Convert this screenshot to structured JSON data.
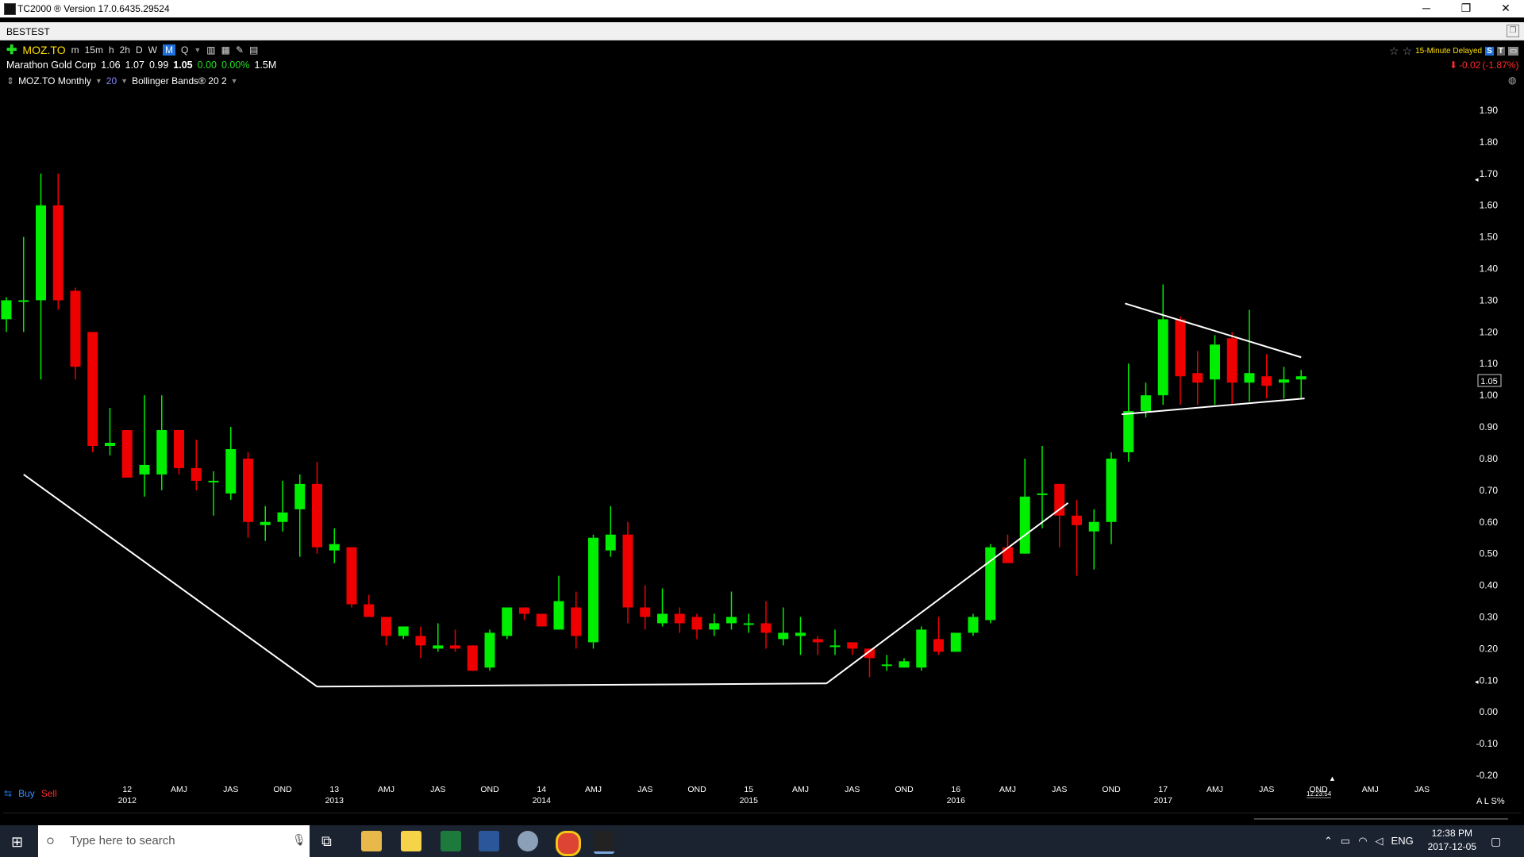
{
  "window": {
    "title": "TC2000 ® Version 17.0.6435.29524",
    "layout_name": "BESTEST",
    "controls": [
      "─",
      "❐",
      "✕"
    ]
  },
  "chart_header": {
    "symbol": "MOZ.TO",
    "timeframes": [
      "m",
      "15m",
      "h",
      "2h",
      "D",
      "W",
      "M",
      "Q"
    ],
    "active_timeframe": "M",
    "delayed_label": "15-Minute Delayed",
    "company": "Marathon Gold Corp",
    "open": "1.06",
    "high": "1.07",
    "low": "0.99",
    "close": "1.05",
    "change": "0.00",
    "change_pct": "0.00%",
    "volume": "1.5M",
    "day_change": "-0.02",
    "day_change_pct": "(-1.87%)",
    "plot_label": "MOZ.TO Monthly",
    "plot_period": "20",
    "study_label": "Bollinger Bands® 20 2",
    "buy_label": "Buy",
    "sell_label": "Sell",
    "clock": "12:23:54",
    "scale_label": "A L S%",
    "price_marker": "1.05"
  },
  "colors": {
    "up": "#00ee00",
    "down": "#ee0000",
    "background": "#000000",
    "trendline": "#ffffff",
    "accent": "#1e6fd9"
  },
  "chart_data": {
    "type": "candlestick",
    "title": "MOZ.TO Monthly",
    "ylim": [
      -0.2,
      1.9
    ],
    "y_ticks": [
      "1.90",
      "1.80",
      "1.70",
      "1.60",
      "1.50",
      "1.40",
      "1.30",
      "1.20",
      "1.10",
      "1.00",
      "0.90",
      "0.80",
      "0.70",
      "0.60",
      "0.50",
      "0.40",
      "0.30",
      "0.20",
      "0.10",
      "0.00",
      "-0.10",
      "-0.20"
    ],
    "x_labels": [
      {
        "top": "12",
        "bottom": "2012"
      },
      {
        "top": "AMJ",
        "bottom": ""
      },
      {
        "top": "JAS",
        "bottom": ""
      },
      {
        "top": "OND",
        "bottom": ""
      },
      {
        "top": "13",
        "bottom": "2013"
      },
      {
        "top": "AMJ",
        "bottom": ""
      },
      {
        "top": "JAS",
        "bottom": ""
      },
      {
        "top": "OND",
        "bottom": ""
      },
      {
        "top": "14",
        "bottom": "2014"
      },
      {
        "top": "AMJ",
        "bottom": ""
      },
      {
        "top": "JAS",
        "bottom": ""
      },
      {
        "top": "OND",
        "bottom": ""
      },
      {
        "top": "15",
        "bottom": "2015"
      },
      {
        "top": "AMJ",
        "bottom": ""
      },
      {
        "top": "JAS",
        "bottom": ""
      },
      {
        "top": "OND",
        "bottom": ""
      },
      {
        "top": "16",
        "bottom": "2016"
      },
      {
        "top": "AMJ",
        "bottom": ""
      },
      {
        "top": "JAS",
        "bottom": ""
      },
      {
        "top": "OND",
        "bottom": ""
      },
      {
        "top": "17",
        "bottom": "2017"
      },
      {
        "top": "AMJ",
        "bottom": ""
      },
      {
        "top": "JAS",
        "bottom": ""
      },
      {
        "top": "OND",
        "bottom": ""
      },
      {
        "top": "AMJ",
        "bottom": ""
      },
      {
        "top": "JAS",
        "bottom": ""
      }
    ],
    "candles": [
      [
        1.24,
        1.31,
        1.2,
        1.3
      ],
      [
        1.3,
        1.5,
        1.2,
        1.3
      ],
      [
        1.3,
        1.7,
        1.05,
        1.6
      ],
      [
        1.6,
        1.7,
        1.27,
        1.3
      ],
      [
        1.33,
        1.34,
        1.05,
        1.09
      ],
      [
        1.2,
        1.2,
        0.82,
        0.84
      ],
      [
        0.84,
        0.96,
        0.81,
        0.85
      ],
      [
        0.89,
        0.89,
        0.75,
        0.74
      ],
      [
        0.75,
        1.0,
        0.68,
        0.78
      ],
      [
        0.75,
        1.0,
        0.7,
        0.89
      ],
      [
        0.89,
        0.89,
        0.75,
        0.77
      ],
      [
        0.77,
        0.86,
        0.7,
        0.73
      ],
      [
        0.73,
        0.76,
        0.62,
        0.73
      ],
      [
        0.69,
        0.9,
        0.67,
        0.83
      ],
      [
        0.8,
        0.82,
        0.55,
        0.6
      ],
      [
        0.59,
        0.65,
        0.54,
        0.6
      ],
      [
        0.6,
        0.73,
        0.57,
        0.63
      ],
      [
        0.64,
        0.75,
        0.49,
        0.72
      ],
      [
        0.72,
        0.79,
        0.5,
        0.52
      ],
      [
        0.51,
        0.58,
        0.47,
        0.53
      ],
      [
        0.52,
        0.52,
        0.33,
        0.34
      ],
      [
        0.34,
        0.37,
        0.3,
        0.3
      ],
      [
        0.3,
        0.3,
        0.21,
        0.24
      ],
      [
        0.24,
        0.27,
        0.23,
        0.27
      ],
      [
        0.24,
        0.27,
        0.17,
        0.21
      ],
      [
        0.2,
        0.28,
        0.19,
        0.21
      ],
      [
        0.21,
        0.26,
        0.19,
        0.2
      ],
      [
        0.21,
        0.21,
        0.13,
        0.13
      ],
      [
        0.14,
        0.26,
        0.13,
        0.25
      ],
      [
        0.24,
        0.33,
        0.23,
        0.33
      ],
      [
        0.33,
        0.33,
        0.29,
        0.31
      ],
      [
        0.31,
        0.31,
        0.27,
        0.27
      ],
      [
        0.26,
        0.43,
        0.26,
        0.35
      ],
      [
        0.33,
        0.38,
        0.2,
        0.24
      ],
      [
        0.22,
        0.56,
        0.2,
        0.55
      ],
      [
        0.51,
        0.65,
        0.49,
        0.56
      ],
      [
        0.56,
        0.6,
        0.28,
        0.33
      ],
      [
        0.33,
        0.4,
        0.26,
        0.3
      ],
      [
        0.28,
        0.39,
        0.27,
        0.31
      ],
      [
        0.31,
        0.33,
        0.25,
        0.28
      ],
      [
        0.3,
        0.31,
        0.23,
        0.26
      ],
      [
        0.26,
        0.31,
        0.24,
        0.28
      ],
      [
        0.28,
        0.38,
        0.26,
        0.3
      ],
      [
        0.28,
        0.31,
        0.25,
        0.28
      ],
      [
        0.28,
        0.35,
        0.2,
        0.25
      ],
      [
        0.23,
        0.33,
        0.21,
        0.25
      ],
      [
        0.24,
        0.3,
        0.18,
        0.25
      ],
      [
        0.23,
        0.24,
        0.18,
        0.22
      ],
      [
        0.21,
        0.26,
        0.18,
        0.21
      ],
      [
        0.22,
        0.22,
        0.18,
        0.2
      ],
      [
        0.2,
        0.2,
        0.11,
        0.17
      ],
      [
        0.15,
        0.18,
        0.13,
        0.15
      ],
      [
        0.14,
        0.17,
        0.14,
        0.16
      ],
      [
        0.14,
        0.27,
        0.13,
        0.26
      ],
      [
        0.23,
        0.3,
        0.18,
        0.19
      ],
      [
        0.19,
        0.25,
        0.19,
        0.25
      ],
      [
        0.25,
        0.31,
        0.24,
        0.3
      ],
      [
        0.29,
        0.53,
        0.28,
        0.52
      ],
      [
        0.52,
        0.56,
        0.48,
        0.47
      ],
      [
        0.5,
        0.8,
        0.5,
        0.68
      ],
      [
        0.69,
        0.84,
        0.58,
        0.69
      ],
      [
        0.72,
        0.72,
        0.52,
        0.62
      ],
      [
        0.62,
        0.67,
        0.43,
        0.59
      ],
      [
        0.57,
        0.64,
        0.45,
        0.6
      ],
      [
        0.6,
        0.82,
        0.53,
        0.8
      ],
      [
        0.82,
        1.1,
        0.79,
        0.95
      ],
      [
        0.95,
        1.04,
        0.93,
        1.0
      ],
      [
        1.0,
        1.35,
        0.97,
        1.24
      ],
      [
        1.24,
        1.25,
        0.97,
        1.06
      ],
      [
        1.07,
        1.14,
        0.97,
        1.04
      ],
      [
        1.05,
        1.19,
        0.97,
        1.16
      ],
      [
        1.18,
        1.2,
        0.97,
        1.04
      ],
      [
        1.04,
        1.27,
        0.98,
        1.07
      ],
      [
        1.06,
        1.13,
        0.99,
        1.03
      ],
      [
        1.04,
        1.09,
        0.99,
        1.05
      ],
      [
        1.05,
        1.08,
        0.99,
        1.06
      ]
    ],
    "trendlines": [
      [
        [
          1.0,
          0.75
        ],
        [
          18.0,
          0.08
        ]
      ],
      [
        [
          18.0,
          0.08
        ],
        [
          47.5,
          0.09
        ]
      ],
      [
        [
          47.5,
          0.09
        ],
        [
          61.5,
          0.66
        ]
      ],
      [
        [
          64.8,
          1.29
        ],
        [
          75.0,
          1.12
        ]
      ],
      [
        [
          64.6,
          0.94
        ],
        [
          75.2,
          0.99
        ]
      ]
    ],
    "ylabel": "",
    "xlabel": "",
    "grid": false
  },
  "taskbar": {
    "search_placeholder": "Type here to search",
    "time": "12:38 PM",
    "date": "2017-12-05",
    "lang": "ENG"
  }
}
